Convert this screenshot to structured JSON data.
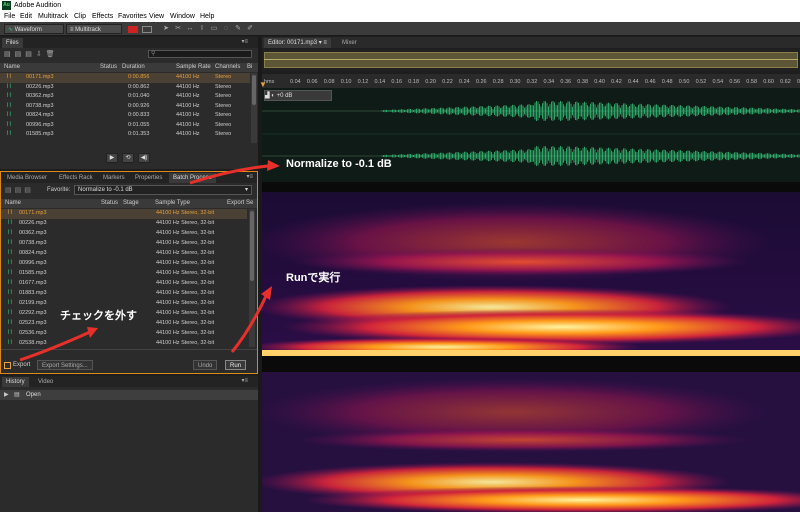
{
  "app": {
    "title": "Adobe Audition",
    "logo": "Au"
  },
  "menu": [
    "File",
    "Edit",
    "Multitrack",
    "Clip",
    "Effects",
    "Favorites",
    "View",
    "Window",
    "Help"
  ],
  "toolbar": {
    "waveform": "Waveform",
    "multitrack": "Multitrack"
  },
  "files_panel": {
    "tab": "Files",
    "columns": [
      "Name",
      "Status",
      "Duration",
      "Sample Rate",
      "Channels",
      "Bi"
    ],
    "rows": [
      {
        "name": "00171.mp3",
        "duration": "0:00.856",
        "rate": "44100 Hz",
        "channels": "Stereo"
      },
      {
        "name": "00226.mp3",
        "duration": "0:00.862",
        "rate": "44100 Hz",
        "channels": "Stereo"
      },
      {
        "name": "00362.mp3",
        "duration": "0:01.040",
        "rate": "44100 Hz",
        "channels": "Stereo"
      },
      {
        "name": "00738.mp3",
        "duration": "0:00.926",
        "rate": "44100 Hz",
        "channels": "Stereo"
      },
      {
        "name": "00824.mp3",
        "duration": "0:00.833",
        "rate": "44100 Hz",
        "channels": "Stereo"
      },
      {
        "name": "00996.mp3",
        "duration": "0:01.055",
        "rate": "44100 Hz",
        "channels": "Stereo"
      },
      {
        "name": "01585.mp3",
        "duration": "0:01.353",
        "rate": "44100 Hz",
        "channels": "Stereo"
      }
    ]
  },
  "mid_tabs": [
    "Media Browser",
    "Effects Rack",
    "Markers",
    "Properties",
    "Batch Process"
  ],
  "batch": {
    "favorite_label": "Favorite:",
    "favorite_value": "Normalize to -0.1 dB",
    "columns": [
      "Name",
      "Status",
      "Stage",
      "Sample Type",
      "Export Se"
    ],
    "rows": [
      {
        "name": "00171.mp3",
        "type": "44100 Hz Stereo, 32-bit"
      },
      {
        "name": "00226.mp3",
        "type": "44100 Hz Stereo, 32-bit"
      },
      {
        "name": "00362.mp3",
        "type": "44100 Hz Stereo, 32-bit"
      },
      {
        "name": "00738.mp3",
        "type": "44100 Hz Stereo, 32-bit"
      },
      {
        "name": "00824.mp3",
        "type": "44100 Hz Stereo, 32-bit"
      },
      {
        "name": "00996.mp3",
        "type": "44100 Hz Stereo, 32-bit"
      },
      {
        "name": "01585.mp3",
        "type": "44100 Hz Stereo, 32-bit"
      },
      {
        "name": "01677.mp3",
        "type": "44100 Hz Stereo, 32-bit"
      },
      {
        "name": "01883.mp3",
        "type": "44100 Hz Stereo, 32-bit"
      },
      {
        "name": "02199.mp3",
        "type": "44100 Hz Stereo, 32-bit"
      },
      {
        "name": "02292.mp3",
        "type": "44100 Hz Stereo, 32-bit"
      },
      {
        "name": "02523.mp3",
        "type": "44100 Hz Stereo, 32-bit"
      },
      {
        "name": "02536.mp3",
        "type": "44100 Hz Stereo, 32-bit"
      },
      {
        "name": "02538.mp3",
        "type": "44100 Hz Stereo, 32-bit"
      }
    ],
    "export_label": "Export",
    "export_settings": "Export Settings...",
    "undo": "Undo",
    "run": "Run"
  },
  "bottom_tabs": [
    "History",
    "Video"
  ],
  "history": {
    "item": "Open"
  },
  "editor": {
    "tab": "Editor: 00171.mp3",
    "mixer": "Mixer",
    "db_label": "+0 dB"
  },
  "ruler": {
    "unit": "hms",
    "ticks": [
      "0.04",
      "0.06",
      "0.08",
      "0.10",
      "0.12",
      "0.14",
      "0.16",
      "0.18",
      "0.20",
      "0.22",
      "0.24",
      "0.26",
      "0.28",
      "0.30",
      "0.32",
      "0.34",
      "0.36",
      "0.38",
      "0.40",
      "0.42",
      "0.44",
      "0.46",
      "0.48",
      "0.50",
      "0.52",
      "0.54",
      "0.56",
      "0.58",
      "0.60",
      "0.62",
      "0.64"
    ]
  },
  "annotations": {
    "normalize": "Normalize to -0.1 dB",
    "run": "Runで実行",
    "uncheck": "チェックを外す"
  },
  "colors": {
    "accent": "#e6a13c",
    "wave": "#34c77b",
    "arrow": "#e8302a"
  }
}
